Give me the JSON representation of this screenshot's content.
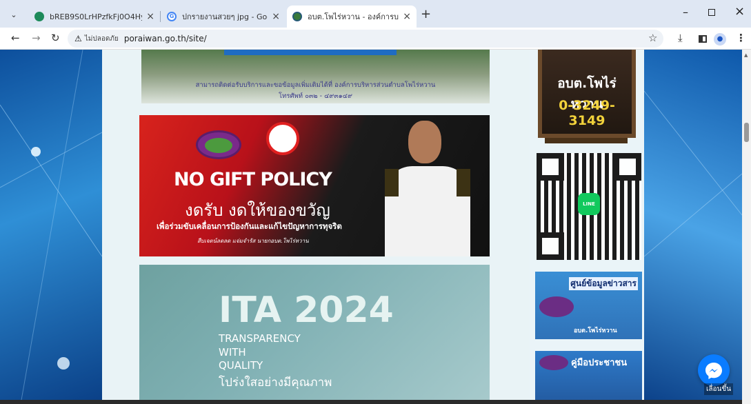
{
  "browser": {
    "tabs": [
      {
        "title": "bREB9S0LrHPzfkFj0O4HyzK51x..."
      },
      {
        "title": "ปกรายงานสวยๆ jpg - Google Sea..."
      },
      {
        "title": "อบต.โพไร่หวาน - องค์การบริหารส่วน..."
      }
    ],
    "security_label": "ไม่ปลอดภัย",
    "url": "poraiwan.go.th/site/"
  },
  "top_banner": {
    "line1": "สามารถติดต่อรับบริการและขอข้อมูลเพิ่มเติมได้ที่ องค์การบริหารส่วนตำบลโพไร่หวาน",
    "line2": "โทรศัพท์ ๐๓๒ - ๔๙๓๑๔๙"
  },
  "gift_banner": {
    "title": "NO GIFT POLICY",
    "thai_title": "งดรับ งดให้ของขวัญ",
    "subtitle": "เพื่อร่วมขับเคลื่อนการป้องกันและแก้ไขปัญหาการทุจริต",
    "signature": "สืบเจตน์ลดลด แจ่มจำรัส นายกอบต.โพไร่หวาน"
  },
  "ita_banner": {
    "title": "ITA 2024",
    "line1": "TRANSPARENCY",
    "line2": "WITH",
    "line3": "QUALITY",
    "thai": "โปร่งใสอย่างมีคุณภาพ"
  },
  "sidebar": {
    "board_line1": "อบต.โพไร่หวาน",
    "board_line2": "0-3249-3149",
    "line_label": "LINE",
    "news_title": "ศูนย์ข้อมูลข่าวสาร",
    "news_sub": "อบต.โพไร่หวาน",
    "manual_title": "คู่มือประชาชน"
  },
  "fab_label": "เลื่อนขึ้น"
}
